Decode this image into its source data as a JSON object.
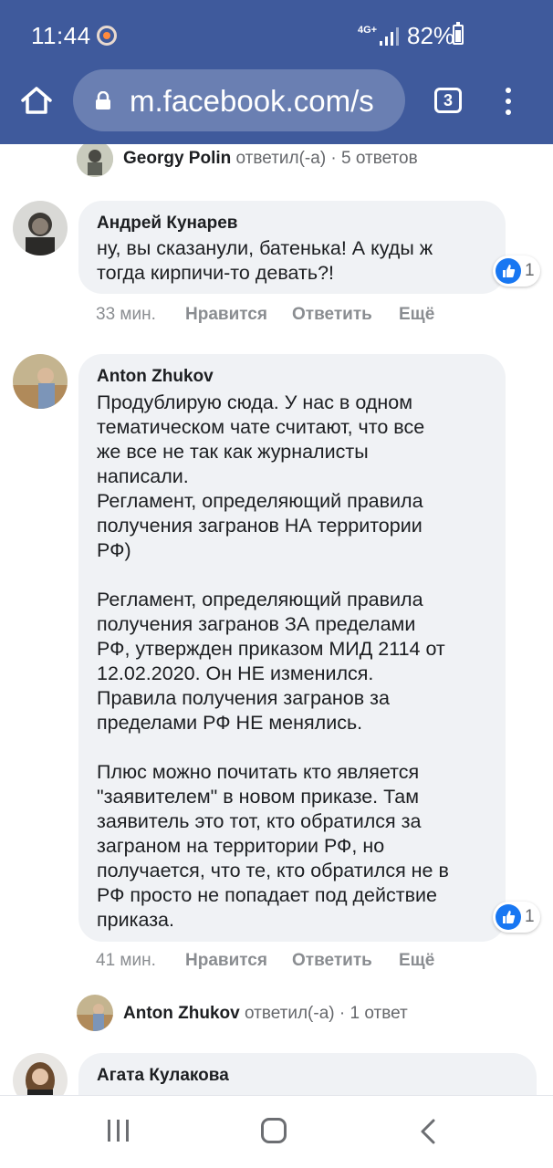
{
  "status_bar": {
    "time": "11:44",
    "network": "4G+",
    "battery": "82%"
  },
  "browser": {
    "url": "m.facebook.com/s",
    "tab_count": "3",
    "theme_color": "#3f5a9c"
  },
  "thread": {
    "reply_summary_1": {
      "name": "Georgy Polin",
      "action": " ответил(-а)",
      "count": " · 5 ответов"
    },
    "comments": [
      {
        "author": "Андрей Кунарев",
        "text": "ну, вы сказанули, батенька! А куды ж\nтогда кирпичи-то девать?!",
        "time": "33 мин.",
        "like": "Нравится",
        "reply": "Ответить",
        "more": "Ещё",
        "reactions": "1"
      },
      {
        "author": "Anton Zhukov",
        "text": "Продублирую сюда. У нас в одном\nтематическом чате считают, что все\nже все не так как журналисты\nнаписали.\nРегламент, определяющий правила\nполучения загранов НА территории\nРФ)\n\nРегламент, определяющий правила\nполучения загранов ЗА пределами\nРФ, утвержден приказом МИД 2114 от\n12.02.2020. Он НЕ изменился.\nПравила получения загранов за\nпределами РФ НЕ менялись.\n\nПлюс можно почитать кто является\n\"заявителем\" в новом приказе. Там\nзаявитель это тот, кто обратился за\nзаграном на территории РФ, но\nполучается, что те, кто обратился не в\nРФ просто не попадает под действие\nприказа.",
        "time": "41 мин.",
        "like": "Нравится",
        "reply": "Ответить",
        "more": "Ещё",
        "reactions": "1"
      },
      {
        "author": "Агата Кулакова"
      }
    ],
    "reply_summary_2": {
      "name": "Anton Zhukov",
      "action": " ответил(-а)",
      "count": " · 1 ответ"
    }
  },
  "icons": {
    "home": "home-icon",
    "lock": "lock-icon",
    "tabs": "tabs-icon",
    "menu": "more-vert-icon",
    "like": "like-icon",
    "accent": "#1877f2"
  }
}
